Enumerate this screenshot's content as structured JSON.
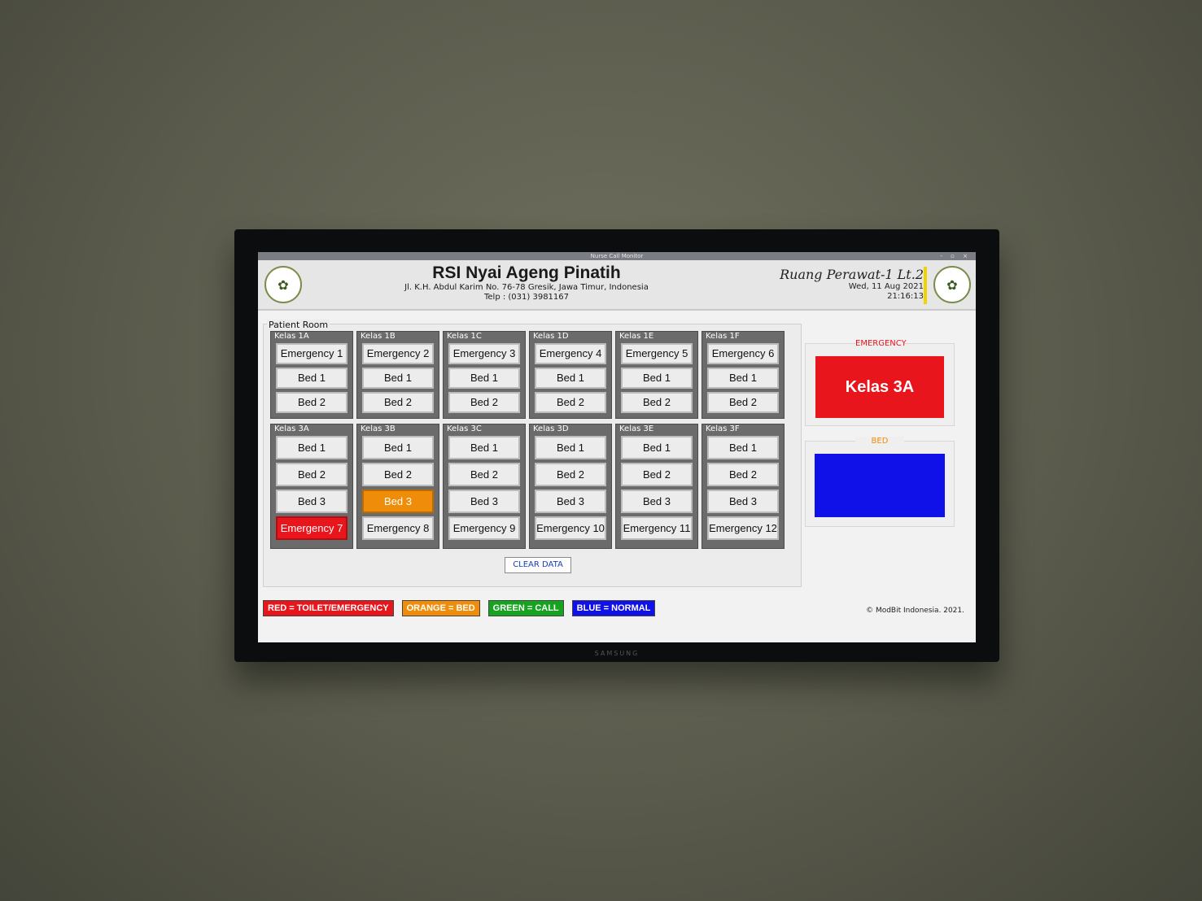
{
  "window_title": "Nurse Call Monitor",
  "window_controls": "- ▫ ×",
  "header": {
    "hospital_name": "RSI Nyai Ageng Pinatih",
    "address": "Jl. K.H. Abdul Karim No. 76-78 Gresik, Jawa Timur, Indonesia",
    "telp": "Telp : (031) 3981167",
    "room": "Ruang Perawat-1 Lt.2",
    "date": "Wed, 11 Aug 2021",
    "time": "21:16:13"
  },
  "panel_label": "Patient Room",
  "groups_top": [
    {
      "label": "Kelas 1A",
      "buttons": [
        "Emergency 1",
        "Bed 1",
        "Bed 2"
      ]
    },
    {
      "label": "Kelas 1B",
      "buttons": [
        "Emergency 2",
        "Bed 1",
        "Bed 2"
      ]
    },
    {
      "label": "Kelas 1C",
      "buttons": [
        "Emergency 3",
        "Bed 1",
        "Bed 2"
      ]
    },
    {
      "label": "Kelas 1D",
      "buttons": [
        "Emergency 4",
        "Bed 1",
        "Bed 2"
      ]
    },
    {
      "label": "Kelas 1E",
      "buttons": [
        "Emergency 5",
        "Bed 1",
        "Bed 2"
      ]
    },
    {
      "label": "Kelas 1F",
      "buttons": [
        "Emergency 6",
        "Bed 1",
        "Bed 2"
      ]
    }
  ],
  "groups_bottom": [
    {
      "label": "Kelas 3A",
      "buttons": [
        "Bed 1",
        "Bed 2",
        "Bed 3",
        "Emergency 7"
      ],
      "states": [
        "",
        "",
        "",
        "red"
      ]
    },
    {
      "label": "Kelas 3B",
      "buttons": [
        "Bed 1",
        "Bed 2",
        "Bed 3",
        "Emergency 8"
      ],
      "states": [
        "",
        "",
        "orange",
        ""
      ]
    },
    {
      "label": "Kelas 3C",
      "buttons": [
        "Bed 1",
        "Bed 2",
        "Bed 3",
        "Emergency 9"
      ],
      "states": [
        "",
        "",
        "",
        ""
      ]
    },
    {
      "label": "Kelas 3D",
      "buttons": [
        "Bed 1",
        "Bed 2",
        "Bed 3",
        "Emergency 10"
      ],
      "states": [
        "",
        "",
        "",
        ""
      ]
    },
    {
      "label": "Kelas 3E",
      "buttons": [
        "Bed 1",
        "Bed 2",
        "Bed 3",
        "Emergency 11"
      ],
      "states": [
        "",
        "",
        "",
        ""
      ]
    },
    {
      "label": "Kelas 3F",
      "buttons": [
        "Bed 1",
        "Bed 2",
        "Bed 3",
        "Emergency 12"
      ],
      "states": [
        "",
        "",
        "",
        ""
      ]
    }
  ],
  "clear_label": "CLEAR DATA",
  "emergency_panel": {
    "title": "EMERGENCY",
    "value": "Kelas 3A",
    "color": "#e8151c"
  },
  "bed_panel": {
    "title": "BED",
    "value": "",
    "color": "#1010e8"
  },
  "legend": [
    {
      "text": "RED = TOILET/EMERGENCY",
      "color": "#e8151c"
    },
    {
      "text": "ORANGE = BED",
      "color": "#ef8d0a"
    },
    {
      "text": "GREEN = CALL",
      "color": "#16a31f"
    },
    {
      "text": "BLUE = NORMAL",
      "color": "#1010e8"
    }
  ],
  "copyright": "© ModBit Indonesia. 2021.",
  "tv_brand": "SAMSUNG"
}
